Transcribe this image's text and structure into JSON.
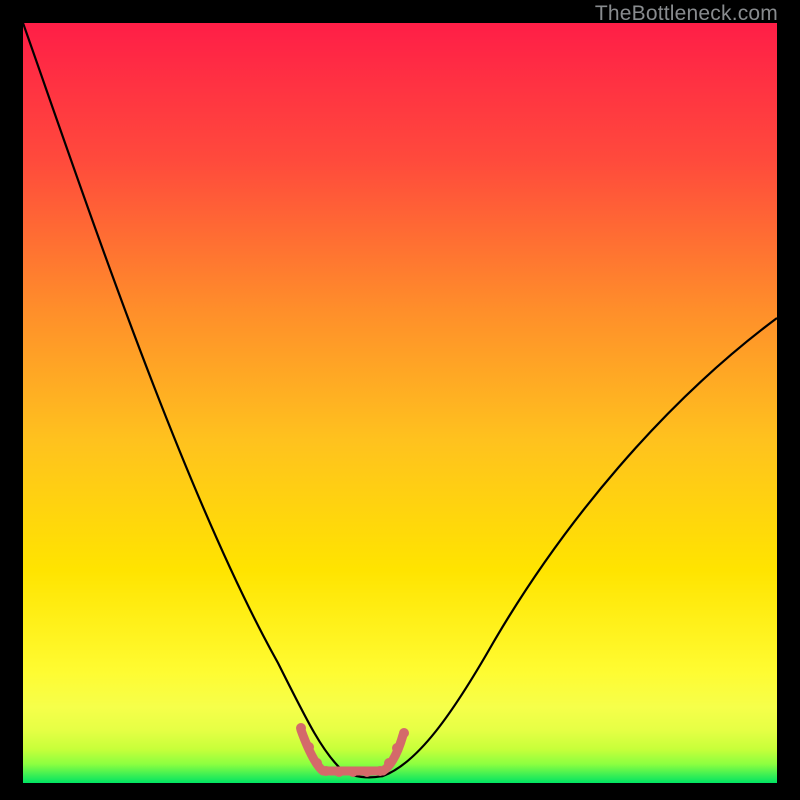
{
  "watermark": "TheBottleneck.com",
  "colors": {
    "bg_black": "#000000",
    "grad_top": "#ff1e47",
    "grad_mid": "#ffd400",
    "grad_low": "#f6ff4a",
    "grad_bottom": "#00e463",
    "curve": "#000000",
    "dotted": "#d46a6a"
  },
  "chart_data": {
    "type": "line",
    "title": "",
    "xlabel": "",
    "ylabel": "",
    "xlim": [
      0,
      100
    ],
    "ylim": [
      0,
      100
    ],
    "grid": false,
    "legend": null,
    "series": [
      {
        "name": "bottleneck-curve",
        "x": [
          0,
          4,
          8,
          12,
          16,
          20,
          24,
          28,
          32,
          35,
          38,
          40,
          42,
          44,
          46,
          48,
          52,
          56,
          60,
          65,
          70,
          75,
          80,
          85,
          90,
          95,
          100
        ],
        "y": [
          100,
          89,
          78,
          67,
          56,
          46,
          36,
          27,
          18,
          11,
          6,
          3,
          1,
          0.5,
          0.5,
          1,
          4,
          9,
          15,
          22,
          29,
          35,
          41,
          47,
          52,
          57,
          62
        ]
      }
    ],
    "flat_region": {
      "x_start": 37,
      "x_end": 50,
      "y": 1
    },
    "background_gradient_stops": [
      {
        "offset": 0.0,
        "color": "#ff1e47"
      },
      {
        "offset": 0.5,
        "color": "#ffb000"
      },
      {
        "offset": 0.78,
        "color": "#ffe800"
      },
      {
        "offset": 0.9,
        "color": "#f6ff4a"
      },
      {
        "offset": 0.96,
        "color": "#c8ff3a"
      },
      {
        "offset": 1.0,
        "color": "#00e463"
      }
    ]
  }
}
